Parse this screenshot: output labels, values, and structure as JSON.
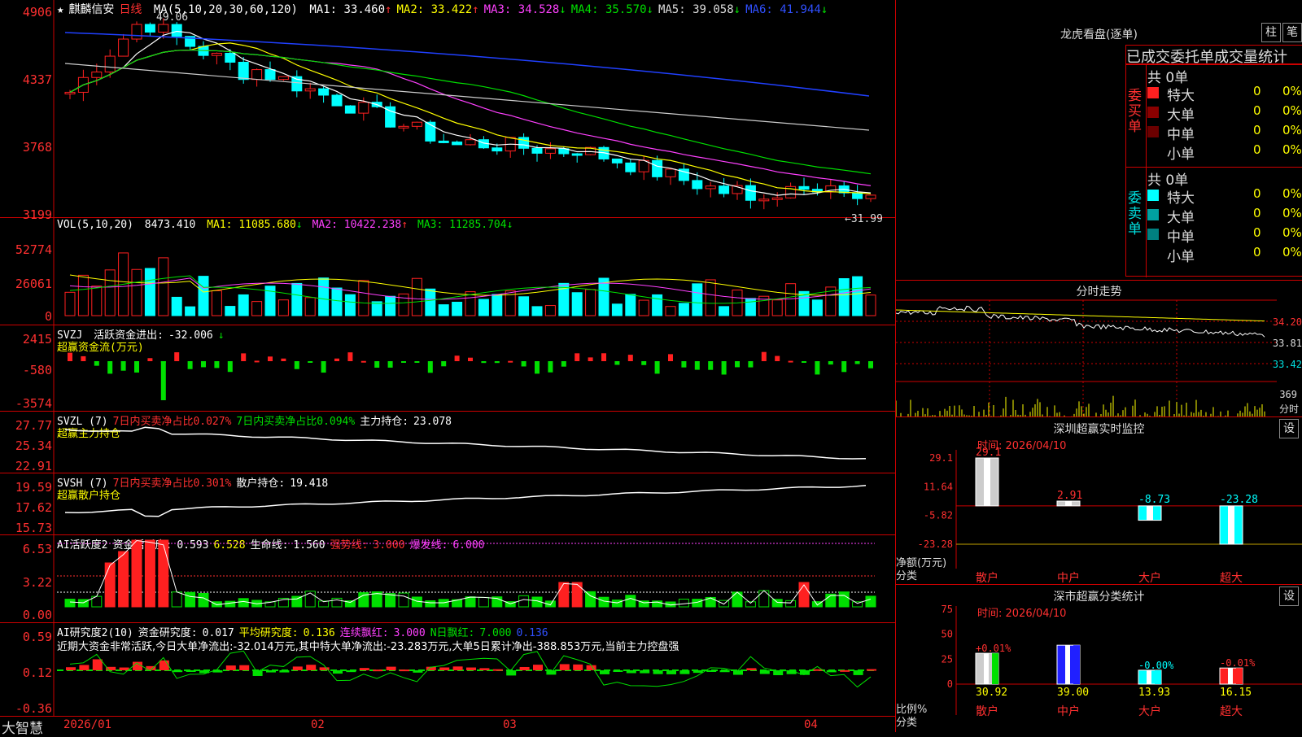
{
  "brand": "大智慧",
  "stock": {
    "name": "麒麟信安",
    "period": "日线",
    "close_marker": "★"
  },
  "price_panel": {
    "ma_label": "MA(5,10,20,30,60,120)",
    "ma": [
      {
        "label": "MA1:",
        "value": "33.460",
        "arrow": "↑",
        "color": "#ffffff"
      },
      {
        "label": "MA2:",
        "value": "33.422",
        "arrow": "↑",
        "color": "#ffff00"
      },
      {
        "label": "MA3:",
        "value": "34.528",
        "arrow": "↓",
        "color": "#ff40ff"
      },
      {
        "label": "MA4:",
        "value": "35.570",
        "arrow": "↓",
        "color": "#00e000"
      },
      {
        "label": "MA5:",
        "value": "39.058",
        "arrow": "↓",
        "color": "#dddddd"
      },
      {
        "label": "MA6:",
        "value": "41.944",
        "arrow": "↓",
        "color": "#3050ff"
      }
    ],
    "yticks": [
      "4906",
      "4337",
      "3768",
      "3199"
    ],
    "hi_label": "49.06",
    "lo_label": "←31.99"
  },
  "vol_panel": {
    "label": "VOL(5,10,20)",
    "value": "8473.410",
    "arrow": "↓",
    "ma": [
      {
        "label": "MA1:",
        "value": "11085.680",
        "arrow": "↓",
        "color": "#ffff00"
      },
      {
        "label": "MA2:",
        "value": "10422.238",
        "arrow": "↑",
        "color": "#ff40ff"
      },
      {
        "label": "MA3:",
        "value": "11285.704",
        "arrow": "↓",
        "color": "#00e000"
      }
    ],
    "yticks": [
      "52774",
      "26061",
      "0"
    ]
  },
  "svzj_panel": {
    "label": "SVZJ",
    "item": "活跃资金进出:",
    "value": "-32.006",
    "arrow": "↓",
    "sub": "超赢资金流(万元)",
    "yticks": [
      "2415",
      "-580",
      "-3574"
    ]
  },
  "svzl_panel": {
    "label": "SVZL (7)",
    "t1": "7日内买卖净占比0.027%",
    "t2": "7日内买卖净占比0.094%",
    "item": "主力持仓:",
    "value": "23.078",
    "arrow": "↓",
    "sub": "超赢主力持仓",
    "yticks": [
      "27.77",
      "25.34",
      "22.91"
    ]
  },
  "svsh_panel": {
    "label": "SVSH (7)",
    "t1": "7日内买卖净占比0.301%",
    "item": "散户持仓:",
    "value": "19.418",
    "arrow": "↑",
    "sub": "超赢散户持仓",
    "yticks": [
      "19.59",
      "17.62",
      "15.73"
    ]
  },
  "ai1_panel": {
    "label": "AI活跃度2",
    "item": "资金活跃度:",
    "value": "0.593",
    "arrow": "↓",
    "v2": "6.528",
    "life": "生命线:",
    "lifev": "1.560",
    "strong": "强势线:",
    "strongv": "3.000",
    "burst": "爆发线:",
    "burstv": "6.000",
    "yticks": [
      "6.53",
      "3.22",
      "0.00"
    ]
  },
  "ai2_panel": {
    "label": "AI研究度2(10)",
    "item": "资金研究度:",
    "value": "0.017",
    "arrow": "↓",
    "avg": "平均研究度:",
    "avgv": "0.136",
    "cont": "连续飘红:",
    "contv": "3.000",
    "nday": "N日飘红:",
    "ndayv": "7.000",
    "last": "0.136",
    "yticks": [
      "0.59",
      "0.12",
      "-0.36"
    ],
    "note": "近期大资金非常活跃,今日大单净流出:-32.014万元,其中特大单净流出:-23.283万元,大单5日累计净出-388.853万元,当前主力控盘强"
  },
  "x_axis": [
    "2026/01",
    "02",
    "03",
    "04"
  ],
  "dragon": {
    "title": "龙虎看盘(逐单)",
    "btn1": "柱",
    "btn2": "笔",
    "subtitle": "已成交委托单成交量统计",
    "buy": {
      "side": "委买单",
      "total": "共 0单",
      "rows": [
        {
          "name": "特大",
          "v": "0",
          "p": "0%",
          "color": "#ff2020"
        },
        {
          "name": "大单",
          "v": "0",
          "p": "0%",
          "color": "#8b0000"
        },
        {
          "name": "中单",
          "v": "0",
          "p": "0%",
          "color": "#6b0000"
        },
        {
          "name": "小单",
          "v": "0",
          "p": "0%",
          "color": "#000000"
        }
      ]
    },
    "sell": {
      "side": "委卖单",
      "total": "共 0单",
      "rows": [
        {
          "name": "特大",
          "v": "0",
          "p": "0%",
          "color": "#00ffff"
        },
        {
          "name": "大单",
          "v": "0",
          "p": "0%",
          "color": "#00a0a0"
        },
        {
          "name": "中单",
          "v": "0",
          "p": "0%",
          "color": "#008080"
        },
        {
          "name": "小单",
          "v": "0",
          "p": "0%",
          "color": "#000000"
        }
      ]
    }
  },
  "intraday": {
    "title": "分时走势",
    "yticks": [
      "34.20",
      "33.81",
      "33.42"
    ],
    "vol_label": "369",
    "time_label": "分时"
  },
  "sz_monitor": {
    "title": "深圳超赢实时监控",
    "btn": "设",
    "time": "时间: 2026/04/10",
    "ylabel": "净额(万元)",
    "xlabel": "分类",
    "yticks": [
      "29.1",
      "11.64",
      "-5.82",
      "-23.28"
    ]
  },
  "sz_class": {
    "title": "深市超赢分类统计",
    "btn": "设",
    "time": "时间: 2026/04/10",
    "ylabel": "比例%",
    "xlabel": "分类",
    "yticks": [
      "75",
      "50",
      "25",
      "0"
    ]
  },
  "chart_data": [
    {
      "type": "candlestick",
      "title": "麒麟信安 日线",
      "ylim": [
        31.99,
        49.06
      ],
      "note": "daily candles Jan-Apr 2026"
    },
    {
      "type": "bar",
      "title": "深圳超赢实时监控",
      "categories": [
        "散户",
        "中户",
        "大户",
        "超大"
      ],
      "values": [
        29.1,
        2.91,
        -8.73,
        -23.28
      ],
      "ylabel": "净额(万元)",
      "ylim": [
        -23.28,
        29.1
      ]
    },
    {
      "type": "bar",
      "title": "深市超赢分类统计",
      "categories": [
        "散户",
        "中户",
        "大户",
        "超大"
      ],
      "series": [
        {
          "name": "比例",
          "values": [
            30.92,
            39.0,
            13.93,
            16.15
          ]
        }
      ],
      "labels": [
        "+0.01%",
        "",
        "-0.00%",
        "-0.01%"
      ],
      "ylabel": "比例%",
      "ylim": [
        0,
        75
      ]
    }
  ]
}
